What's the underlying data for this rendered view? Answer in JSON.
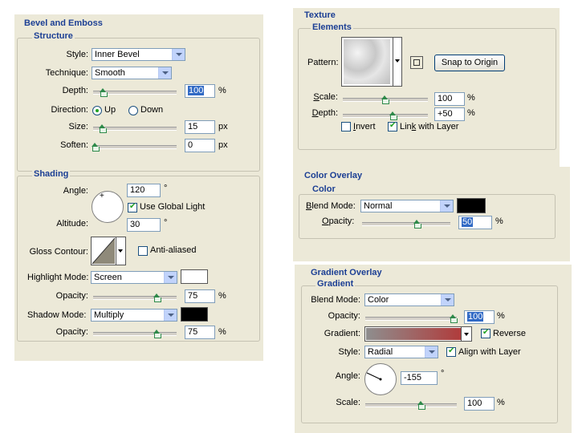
{
  "bevel_emboss": {
    "title": "Bevel and Emboss",
    "structure": {
      "title": "Structure",
      "style_label": "Style:",
      "style_value": "Inner Bevel",
      "technique_label": "Technique:",
      "technique_value": "Smooth",
      "depth_label": "Depth:",
      "depth_value": "100",
      "depth_unit": "%",
      "direction_label": "Direction:",
      "direction_up": "Up",
      "direction_down": "Down",
      "direction_selected": "Up",
      "size_label": "Size:",
      "size_value": "15",
      "size_unit": "px",
      "soften_label": "Soften:",
      "soften_value": "0",
      "soften_unit": "px"
    },
    "shading": {
      "title": "Shading",
      "angle_label": "Angle:",
      "angle_value": "120",
      "angle_unit": "°",
      "use_global_light": "Use Global Light",
      "use_global_light_checked": true,
      "altitude_label": "Altitude:",
      "altitude_value": "30",
      "altitude_unit": "°",
      "gloss_contour_label": "Gloss Contour:",
      "anti_aliased": "Anti-aliased",
      "anti_aliased_checked": false,
      "highlight_mode_label": "Highlight Mode:",
      "highlight_mode_value": "Screen",
      "highlight_color": "#ffffff",
      "highlight_opacity_label": "Opacity:",
      "highlight_opacity_value": "75",
      "highlight_opacity_unit": "%",
      "shadow_mode_label": "Shadow Mode:",
      "shadow_mode_value": "Multiply",
      "shadow_color": "#000000",
      "shadow_opacity_label": "Opacity:",
      "shadow_opacity_value": "75",
      "shadow_opacity_unit": "%"
    }
  },
  "texture": {
    "title": "Texture",
    "elements_title": "Elements",
    "pattern_label": "Pattern:",
    "snap_button": "Snap to Origin",
    "scale_label": "Scale:",
    "scale_value": "100",
    "scale_unit": "%",
    "depth_label": "Depth:",
    "depth_value": "+50",
    "depth_unit": "%",
    "invert_label": "Invert",
    "invert_checked": false,
    "link_label": "Link with Layer",
    "link_checked": true
  },
  "color_overlay": {
    "title": "Color Overlay",
    "color_title": "Color",
    "blend_mode_label": "Blend Mode:",
    "blend_mode_value": "Normal",
    "color": "#000000",
    "opacity_label": "Opacity:",
    "opacity_value": "50",
    "opacity_unit": "%"
  },
  "gradient_overlay": {
    "title": "Gradient Overlay",
    "gradient_title": "Gradient",
    "blend_mode_label": "Blend Mode:",
    "blend_mode_value": "Color",
    "opacity_label": "Opacity:",
    "opacity_value": "100",
    "opacity_unit": "%",
    "gradient_label": "Gradient:",
    "gradient_from": "#8e8e8e",
    "gradient_to": "#b03c3c",
    "reverse_label": "Reverse",
    "reverse_checked": true,
    "style_label": "Style:",
    "style_value": "Radial",
    "align_label": "Align with Layer",
    "align_checked": true,
    "angle_label": "Angle:",
    "angle_value": "-155",
    "angle_unit": "°",
    "scale_label": "Scale:",
    "scale_value": "100",
    "scale_unit": "%"
  }
}
